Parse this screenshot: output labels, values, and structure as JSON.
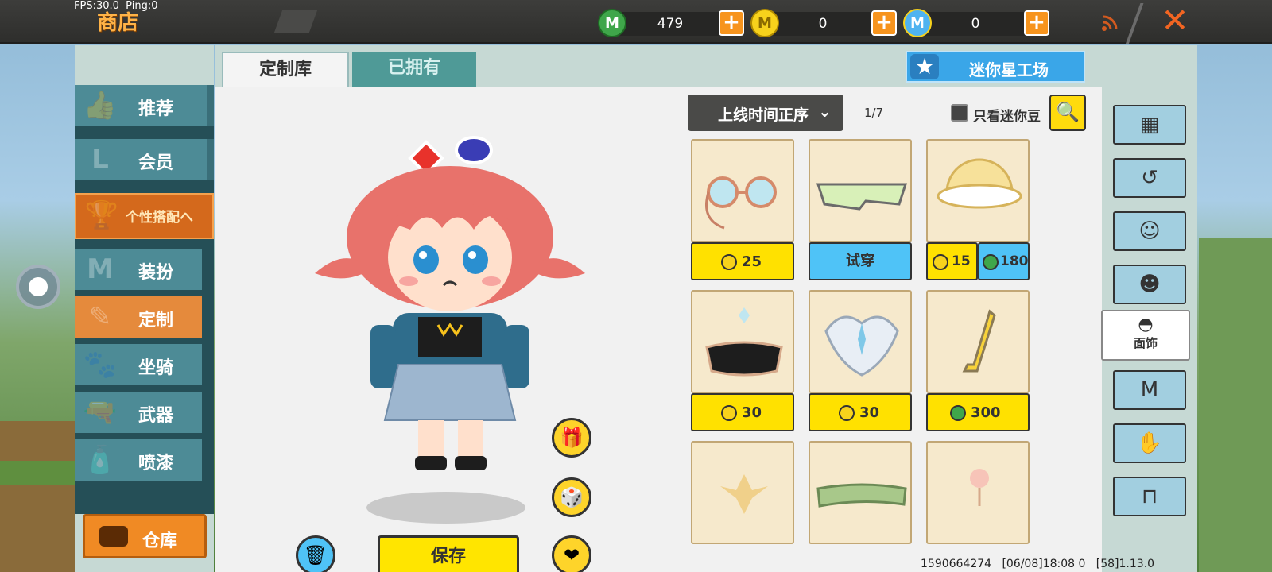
{
  "status": {
    "fps": "FPS:30.0",
    "ping": "Ping:0"
  },
  "header": {
    "title": "商店",
    "currencies": [
      {
        "name": "mini-bean",
        "icon": "green-gem-icon",
        "value": "479",
        "color": "#3fa64a"
      },
      {
        "name": "mini-coin",
        "icon": "gold-coin-icon",
        "value": "0",
        "color": "#f7d21c"
      },
      {
        "name": "mini-point",
        "icon": "blue-coin-icon",
        "value": "0",
        "color": "#4fb3f0"
      }
    ],
    "plus": "+",
    "close": "✕"
  },
  "sidebar": {
    "items": [
      {
        "label": "推荐",
        "icon": "thumb-up-icon",
        "glyph": "👍"
      },
      {
        "label": "会员",
        "icon": "vip-l-icon",
        "glyph": "L"
      },
      {
        "label": "个性搭配へ",
        "icon": "trophy-icon",
        "glyph": "🏆"
      },
      {
        "label": "装扮",
        "icon": "shirt-m-icon",
        "glyph": "M"
      },
      {
        "label": "定制",
        "icon": "pencil-icon",
        "glyph": "✎"
      },
      {
        "label": "坐骑",
        "icon": "mount-icon",
        "glyph": "🐾"
      },
      {
        "label": "武器",
        "icon": "gun-icon",
        "glyph": "🔫"
      },
      {
        "label": "喷漆",
        "icon": "spray-icon",
        "glyph": "🧴"
      }
    ],
    "warehouse": "仓库"
  },
  "tabs": {
    "custom_library": "定制库",
    "owned": "已拥有"
  },
  "workshop": {
    "label": "迷你星工场"
  },
  "sort": {
    "label": "上线时间正序",
    "page": "1/7",
    "only_mini_bean": "只看迷你豆"
  },
  "actions": {
    "save": "保存"
  },
  "items": [
    {
      "name": "round-glasses",
      "price_type": "coin",
      "price": "25"
    },
    {
      "name": "sport-visor",
      "price_type": "try",
      "price": "试穿"
    },
    {
      "name": "yellow-hat",
      "price_type": "split",
      "coin_price": "15",
      "bean_price": "180"
    },
    {
      "name": "black-face-mask",
      "price_type": "coin",
      "price": "30"
    },
    {
      "name": "crystal-crown",
      "price_type": "coin",
      "price": "30"
    },
    {
      "name": "golden-earpiece",
      "price_type": "bean",
      "price": "300"
    },
    {
      "name": "floral-sparkle",
      "price_type": "none"
    },
    {
      "name": "green-headband",
      "price_type": "none"
    },
    {
      "name": "flower-hairpin",
      "price_type": "none"
    }
  ],
  "rightbar": {
    "buttons": [
      "grid-icon",
      "history-icon",
      "hair-face-icon",
      "face-icon",
      "mask-icon",
      "shirt-icon",
      "glove-icon",
      "pants-icon"
    ],
    "active_label": "面饰"
  },
  "footer": {
    "uid": "1590664274",
    "time": "[06/08]18:08 0",
    "version": "[58]1.13.0"
  }
}
